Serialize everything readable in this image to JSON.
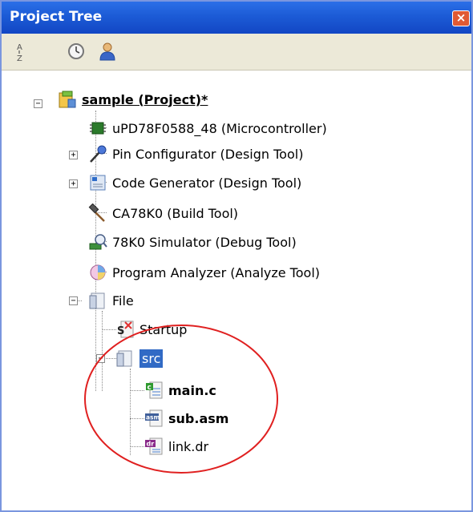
{
  "panel": {
    "title": "Project Tree",
    "close_glyph": "×"
  },
  "toolbar": {
    "buttons": [
      {
        "name": "sort-alphabetical-icon"
      },
      {
        "name": "history-clock-icon"
      },
      {
        "name": "user-profile-icon"
      }
    ]
  },
  "tree": {
    "project": "sample (Project)*",
    "microcontroller": "uPD78F0588_48 (Microcontroller)",
    "pin_configurator": "Pin Configurator (Design Tool)",
    "code_generator": "Code Generator (Design Tool)",
    "build_tool": "CA78K0 (Build Tool)",
    "debug_tool": "78K0 Simulator (Debug Tool)",
    "analyze_tool": "Program Analyzer (Analyze Tool)",
    "file_folder": "File",
    "startup": "Startup",
    "src_folder": "src",
    "files": [
      "main.c",
      "sub.asm",
      "link.dr"
    ]
  },
  "expanders": {
    "collapse": "−",
    "expand": "+"
  },
  "colors": {
    "title_bar": "#1c5bd6",
    "selection": "#316ac5",
    "annotation_circle": "#e02020"
  }
}
